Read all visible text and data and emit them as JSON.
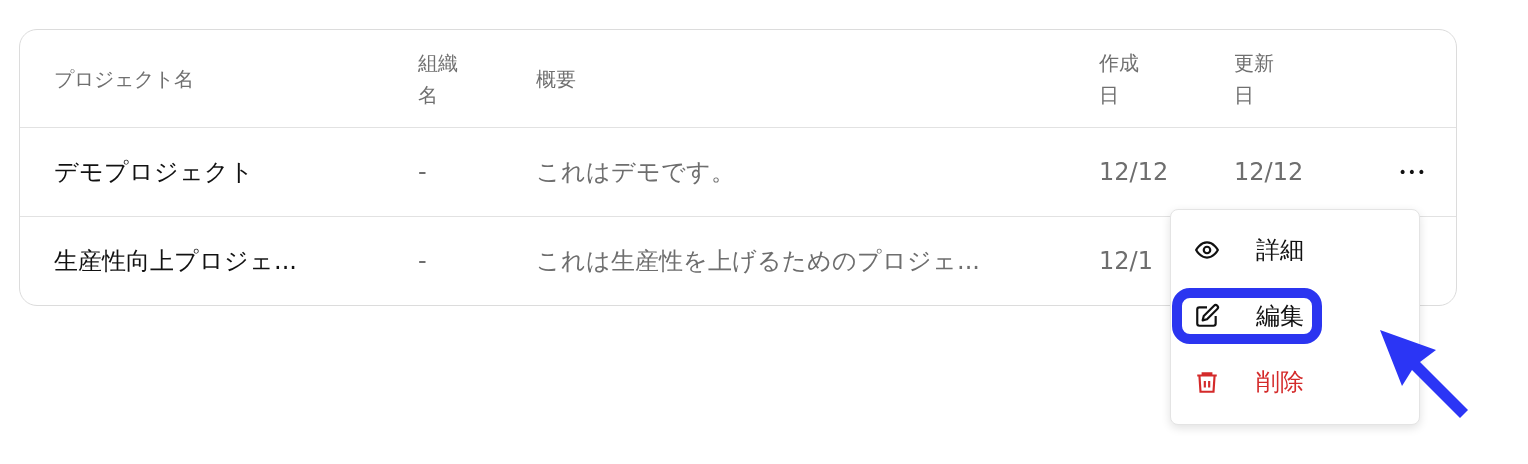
{
  "table": {
    "columns": [
      "プロジェクト名",
      "組織名",
      "概要",
      "作成日",
      "更新日"
    ],
    "rows": [
      {
        "name": "デモプロジェクト",
        "organization": "-",
        "summary": "これはデモです。",
        "created": "12/12",
        "updated": "12/12",
        "actions": "•••"
      },
      {
        "name": "生産性向上プロジェ...",
        "organization": "-",
        "summary": "これは生産性を上げるためのプロジェ...",
        "created": "12/1"
      }
    ]
  },
  "menu": {
    "items": [
      {
        "kind": "view",
        "label": "詳細",
        "highlighted": false
      },
      {
        "kind": "edit",
        "label": "編集",
        "highlighted": true
      },
      {
        "kind": "delete",
        "label": "削除",
        "highlighted": false
      }
    ]
  }
}
